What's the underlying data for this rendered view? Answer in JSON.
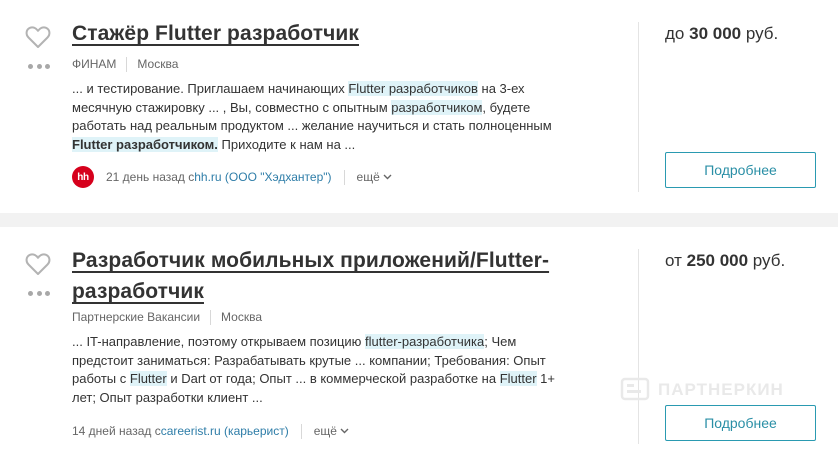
{
  "vacancies": [
    {
      "title": "Стажёр Flutter разработчик",
      "company": "ФИНАМ",
      "city": "Москва",
      "snippet": [
        {
          "t": "... и тестирование. Приглашаем начинающих ",
          "h": 0
        },
        {
          "t": "Flutter разработчиков",
          "h": 1
        },
        {
          "t": " на 3-ех месячную стажировку ... , Вы, совместно с опытным ",
          "h": 0
        },
        {
          "t": "разработчиком",
          "h": 1
        },
        {
          "t": ", будете работать над реальным продуктом ... желание научиться и стать полноценным ",
          "h": 0
        },
        {
          "t": "Flutter разработчиком.",
          "h": 2
        },
        {
          "t": " Приходите к нам на ...",
          "h": 0
        }
      ],
      "source_logo": "hh",
      "time_ago": "21 день назад с ",
      "source_link": "hh.ru (ООО \"Хэдхантер\")",
      "more": "ещё",
      "salary_prefix": "до",
      "salary_amount": "30 000",
      "salary_currency": "руб.",
      "details_button": "Подробнее"
    },
    {
      "title": "Разработчик мобильных приложений/Flutter-разработчик",
      "company": "Партнерские Вакансии",
      "city": "Москва",
      "snippet": [
        {
          "t": "... IT-направление, поэтому открываем позицию ",
          "h": 0
        },
        {
          "t": "flutter-разработчика",
          "h": 1
        },
        {
          "t": "; Чем предстоит заниматься: Разрабатывать крутые ... компании; Требования: Опыт работы с ",
          "h": 0
        },
        {
          "t": "Flutter",
          "h": 1
        },
        {
          "t": " и Dart от года; Опыт ... в коммерческой разработке на ",
          "h": 0
        },
        {
          "t": "Flutter",
          "h": 1
        },
        {
          "t": " 1+ лет; Опыт разработки клиент ...",
          "h": 0
        }
      ],
      "time_ago": "14 дней назад с ",
      "source_link": "careerist.ru (карьерист)",
      "more": "ещё",
      "salary_prefix": "от",
      "salary_amount": "250 000",
      "salary_currency": "руб.",
      "details_button": "Подробнее"
    }
  ],
  "watermark": "ПАРТНЕРКИН",
  "icons": {
    "favorite": "heart-outline-icon",
    "menu": "more-dots-icon",
    "expand": "chevron-down-icon"
  },
  "colors": {
    "accent": "#2a9ab1",
    "highlight": "#dff3f8",
    "hh_red": "#d6001c",
    "link": "#2e7da8"
  }
}
